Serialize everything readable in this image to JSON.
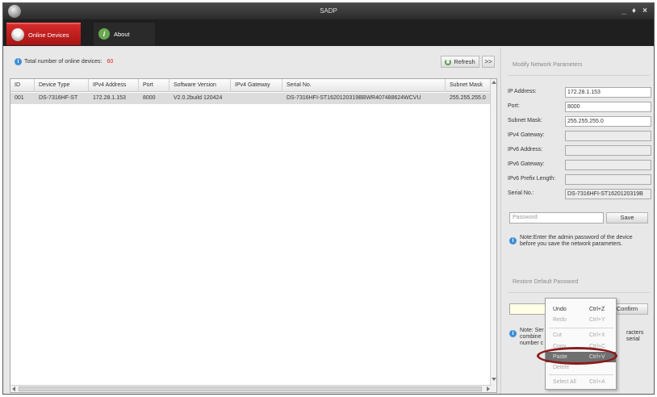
{
  "window": {
    "title": "SADP",
    "controls": [
      "_",
      "♦",
      "×"
    ]
  },
  "tabs": [
    {
      "label": "Online Devices",
      "icon": "user-icon",
      "active": true
    },
    {
      "label": "About",
      "icon": "info-icon",
      "active": false
    }
  ],
  "devices_panel": {
    "summary_label": "Total number of online devices:",
    "count": "60",
    "refresh_label": "Refresh",
    "expand_label": ">>",
    "columns": [
      "ID",
      "Device Type",
      "IPv4 Address",
      "Port",
      "Software Version",
      "IPv4 Gateway",
      "Serial No.",
      "Subnet Mask"
    ],
    "rows": [
      [
        "001",
        "DS-7316HF-ST",
        "172.28.1.153",
        "8000",
        "V2.0.2build 120424",
        "",
        "DS-7316HFI-ST1620120319BBWR407488624WCVU",
        "255.255.255.0"
      ]
    ]
  },
  "network_panel": {
    "title": "Modify Network Parameters",
    "fields": [
      {
        "label": "IP Address:",
        "value": "172.28.1.153",
        "disabled": false
      },
      {
        "label": "Port:",
        "value": "8000",
        "disabled": false
      },
      {
        "label": "Subnet Mask:",
        "value": "255.255.255.0",
        "disabled": false
      },
      {
        "label": "IPv4 Gateway:",
        "value": "",
        "disabled": true
      },
      {
        "label": "IPv6 Address:",
        "value": "",
        "disabled": true
      },
      {
        "label": "IPv6 Gateway:",
        "value": "",
        "disabled": true
      },
      {
        "label": "IPv6 Prefix Length:",
        "value": "",
        "disabled": true
      },
      {
        "label": "Serial No.:",
        "value": "DS-7316HFI-ST1620120319B",
        "disabled": true
      }
    ],
    "password_placeholder": "Password",
    "save_label": "Save",
    "note_line1": "Note:Enter the admin password of the device",
    "note_line2": "before you save the network parameters."
  },
  "restore_panel": {
    "title": "Restore Default Password",
    "confirm_label": "Confirm",
    "note_line1": "Note: Ser",
    "note_line2": "combine",
    "note_line3": "number c",
    "note_right1": "racters",
    "note_right2": "serial"
  },
  "context_menu": {
    "items": [
      {
        "label": "Undo",
        "shortcut": "Ctrl+Z",
        "state": "enabled"
      },
      {
        "label": "Redo",
        "shortcut": "Ctrl+Y",
        "state": "disabled"
      },
      {
        "label": "Cut",
        "shortcut": "Ctrl+X",
        "state": "disabled"
      },
      {
        "label": "Copy",
        "shortcut": "Ctrl+C",
        "state": "disabled"
      },
      {
        "label": "Paste",
        "shortcut": "Ctrl+V",
        "state": "highlighted"
      },
      {
        "label": "Delete",
        "shortcut": "",
        "state": "disabled"
      },
      {
        "label": "Select All",
        "shortcut": "Ctrl+A",
        "state": "disabled"
      }
    ],
    "annotation_color": "#8b1a1a"
  },
  "colors": {
    "accent": "#c81e1e",
    "count": "#e02020",
    "info": "#3d8fd6"
  }
}
